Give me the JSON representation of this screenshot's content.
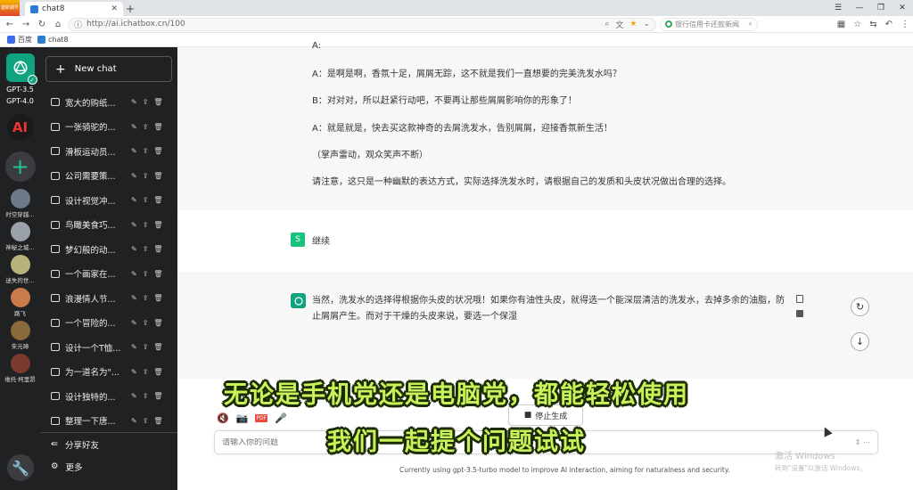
{
  "browser": {
    "badge_text": "建新期号",
    "tab_title": "chat8",
    "url": "http://ai.ichatbox.cn/100",
    "search_placeholder": "银行信用卡还款新闻",
    "bookmarks": [
      {
        "label": "百度",
        "color": "#3b6ee8"
      },
      {
        "label": "chat8",
        "color": "#2b7bd3"
      }
    ]
  },
  "rail": {
    "models": [
      "GPT-3.5",
      "GPT-4.0"
    ],
    "ai_logo": "AI",
    "avatars": [
      {
        "name": "时空穿越..."
      },
      {
        "name": "神秘之城..."
      },
      {
        "name": "迷失的世..."
      },
      {
        "name": "路飞"
      },
      {
        "name": "朱元璋"
      },
      {
        "name": "维托·柯里昂"
      }
    ]
  },
  "sidebar": {
    "new_chat": "New chat",
    "conversations": [
      "宽大的购纸...",
      "一张骑驼的...",
      "滑板运动员...",
      "公司需要策...",
      "设计视觉冲...",
      "鸟瞰美食巧...",
      "梦幻般的动...",
      "一个画家在...",
      "浪漫情人节...",
      "一个冒险的...",
      "设计一个T恤...",
      "为一道名为\"...",
      "设计独特的...",
      "整理一下唐..."
    ],
    "footer": [
      {
        "label": "分享好友",
        "icon": "share-icon"
      },
      {
        "label": "更多",
        "icon": "gear-icon"
      }
    ]
  },
  "conversation": {
    "paragraphs": [
      "A：是啊是啊，香氛十足，屑屑无踪，这不就是我们一直想要的完美洗发水吗？",
      "B：对对对，所以赶紧行动吧，不要再让那些屑屑影响你的形象了！",
      "A：就是就是，快去买这款神奇的去屑洗发水，告别屑屑，迎接香氛新生活！",
      "（掌声雷动，观众笑声不断）",
      "请注意，这只是一种幽默的表达方式，实际选择洗发水时，请根据自己的发质和头皮状况做出合理的选择。"
    ],
    "user_avatar": "S",
    "user_message": "继续",
    "bot_message": "当然，洗发水的选择得根据你头皮的状况哦！如果你有油性头皮，就得选一个能深层清洁的洗发水，去掉多余的油脂，防止屑屑产生。而对于干燥的头皮来说，要选一个保湿"
  },
  "composer": {
    "stop_label": "停止生成",
    "placeholder": "请输入你的问题",
    "footnote": "Currently using gpt-3.5-turbo model to improve AI interaction, aiming for naturalness and security."
  },
  "windows_watermark": {
    "title": "激活 Windows",
    "subtitle": "转到\"设置\"以激活 Windows。"
  },
  "caption": {
    "line1": "无论是手机党还是电脑党，都能轻松使用",
    "line2": "我们一起提个问题试试"
  },
  "colors": {
    "brand_green": "#10a37f",
    "caption_color": "#c7f25a",
    "sidebar_bg": "#202123"
  }
}
